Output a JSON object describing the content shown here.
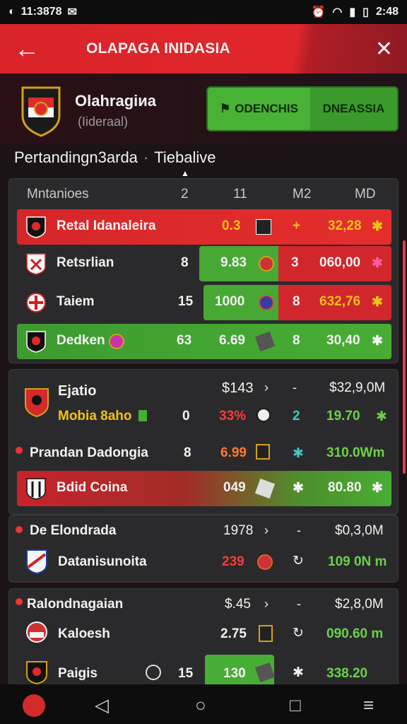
{
  "status": {
    "left_text": "11:3878",
    "time": "2:48"
  },
  "appbar": {
    "title": "OLAPAGA INIDASIA"
  },
  "profile": {
    "name": "Olahragiиa",
    "subtitle": "(Iideraal)"
  },
  "pill": {
    "left_label": "ODENCHIS",
    "right_label": "DNEASSIA"
  },
  "section": {
    "title_left": "Pertandingn3arda",
    "title_right": "Tiebalive"
  },
  "table": {
    "headers": [
      "Mntanioes",
      "2",
      "11",
      "M2",
      "MD"
    ],
    "rows": [
      {
        "name": "Retal Idanaleira",
        "v1": "",
        "v2": "0.3",
        "v3": "",
        "v4": "32,28",
        "style": "red"
      },
      {
        "name": "Retsrlian",
        "v1": "8",
        "v2": "9.83",
        "v3": "3",
        "v4": "060,00",
        "style": "split"
      },
      {
        "name": "Taiem",
        "v1": "15",
        "v2": "1000",
        "v3": "8",
        "v4": "632,76",
        "style": "split2"
      },
      {
        "name": "Dedken",
        "v1": "63",
        "v2": "6.69",
        "v3": "8",
        "v4": "30,40",
        "style": "green"
      }
    ]
  },
  "group1": {
    "title": "Ejatio",
    "price": "$143",
    "right": "$32,9,0M",
    "sub_name": "Mobia 8aho",
    "sub_v1": "0",
    "sub_pct": "33%",
    "sub_v2": "2",
    "sub_v3": "19.70",
    "row1": {
      "name": "Prandan Dadongia",
      "v1": "8",
      "v2": "6.99",
      "v3": "310.0Wm"
    },
    "row2": {
      "name": "Bdid Coina",
      "v1": "049",
      "v2": "",
      "v3": "80.80"
    }
  },
  "group2": {
    "title": "De Elondrada",
    "price": "1978",
    "right": "$0,3,0M",
    "sub_name": "Datanisunoita",
    "sub_v1": "239",
    "sub_v3": "109 0N m"
  },
  "group3": {
    "title": "Ralondnagaian",
    "price": "$.45",
    "right": "$2,8,0M",
    "row1": {
      "name": "Kaloesh",
      "v1": "2.75",
      "v3": "090.60 m"
    },
    "row2": {
      "name": "Paigis",
      "v1": "15",
      "v2": "130",
      "v3": "338.20"
    }
  }
}
